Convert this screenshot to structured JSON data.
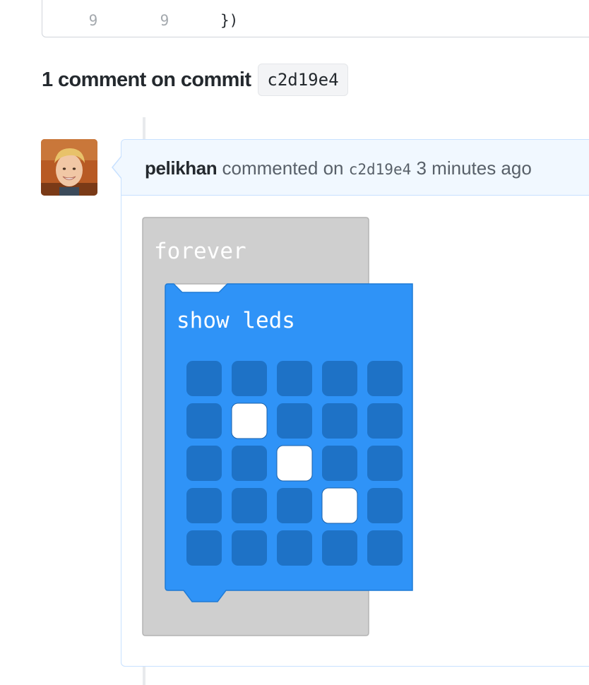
{
  "diff": {
    "rows": [
      {
        "old_line": "9",
        "new_line": "9",
        "code": "})"
      }
    ]
  },
  "comments_section": {
    "count_label": "1 comment on commit",
    "commit_sha": "c2d19e4"
  },
  "comment": {
    "author": "pelikhan",
    "action": "commented on",
    "commit_sha": "c2d19e4",
    "timestamp": "3 minutes ago",
    "attachment": {
      "outer_block_label": "forever",
      "inner_block_label": "show leds",
      "led_grid": [
        [
          0,
          0,
          0,
          0,
          0
        ],
        [
          0,
          1,
          0,
          0,
          0
        ],
        [
          0,
          0,
          1,
          0,
          0
        ],
        [
          0,
          0,
          0,
          1,
          0
        ],
        [
          0,
          0,
          0,
          0,
          0
        ]
      ],
      "colors": {
        "outer_block": "#cfcfcf",
        "inner_block": "#2f93f7",
        "led_off": "#1e72c6",
        "led_on": "#ffffff"
      }
    }
  },
  "colors": {
    "header_bg": "#f1f8ff",
    "border": "#c8e1ff",
    "chip_bg": "#f3f4f6"
  }
}
